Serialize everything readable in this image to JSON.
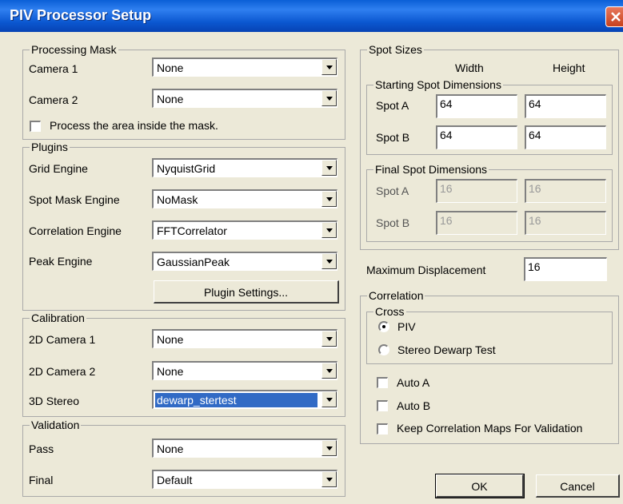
{
  "window": {
    "title": "PIV Processor Setup"
  },
  "processing_mask": {
    "legend": "Processing Mask",
    "camera1": {
      "label": "Camera 1",
      "value": "None"
    },
    "camera2": {
      "label": "Camera 2",
      "value": "None"
    },
    "inside_mask": {
      "label": "Process the area inside the mask.",
      "checked": false
    }
  },
  "plugins": {
    "legend": "Plugins",
    "grid_engine": {
      "label": "Grid Engine",
      "value": "NyquistGrid"
    },
    "spot_mask_engine": {
      "label": "Spot Mask Engine",
      "value": "NoMask"
    },
    "correlation_engine": {
      "label": "Correlation Engine",
      "value": "FFTCorrelator"
    },
    "peak_engine": {
      "label": "Peak Engine",
      "value": "GaussianPeak"
    },
    "settings_button": "Plugin Settings..."
  },
  "calibration": {
    "legend": "Calibration",
    "camera1_2d": {
      "label": "2D Camera 1",
      "value": "None"
    },
    "camera2_2d": {
      "label": "2D Camera 2",
      "value": "None"
    },
    "stereo_3d": {
      "label": "3D Stereo",
      "value": "dewarp_stertest"
    }
  },
  "validation": {
    "legend": "Validation",
    "pass": {
      "label": "Pass",
      "value": "None"
    },
    "final": {
      "label": "Final",
      "value": "Default"
    }
  },
  "spot_sizes": {
    "legend": "Spot Sizes",
    "width_header": "Width",
    "height_header": "Height",
    "starting": {
      "legend": "Starting Spot Dimensions",
      "spot_a": {
        "label": "Spot A",
        "width": "64",
        "height": "64"
      },
      "spot_b": {
        "label": "Spot B",
        "width": "64",
        "height": "64"
      }
    },
    "final": {
      "legend": "Final Spot Dimensions",
      "spot_a": {
        "label": "Spot A",
        "width": "16",
        "height": "16"
      },
      "spot_b": {
        "label": "Spot B",
        "width": "16",
        "height": "16"
      }
    }
  },
  "max_displacement": {
    "label": "Maximum Displacement",
    "value": "16"
  },
  "correlation": {
    "legend": "Correlation",
    "cross": {
      "legend": "Cross",
      "piv": {
        "label": "PIV",
        "selected": true
      },
      "stereo_dewarp": {
        "label": "Stereo Dewarp Test",
        "selected": false
      }
    },
    "auto_a": {
      "label": "Auto A",
      "checked": false
    },
    "auto_b": {
      "label": "Auto B",
      "checked": false
    },
    "keep_maps": {
      "label": "Keep Correlation Maps For Validation",
      "checked": false
    }
  },
  "buttons": {
    "ok": "OK",
    "cancel": "Cancel"
  }
}
